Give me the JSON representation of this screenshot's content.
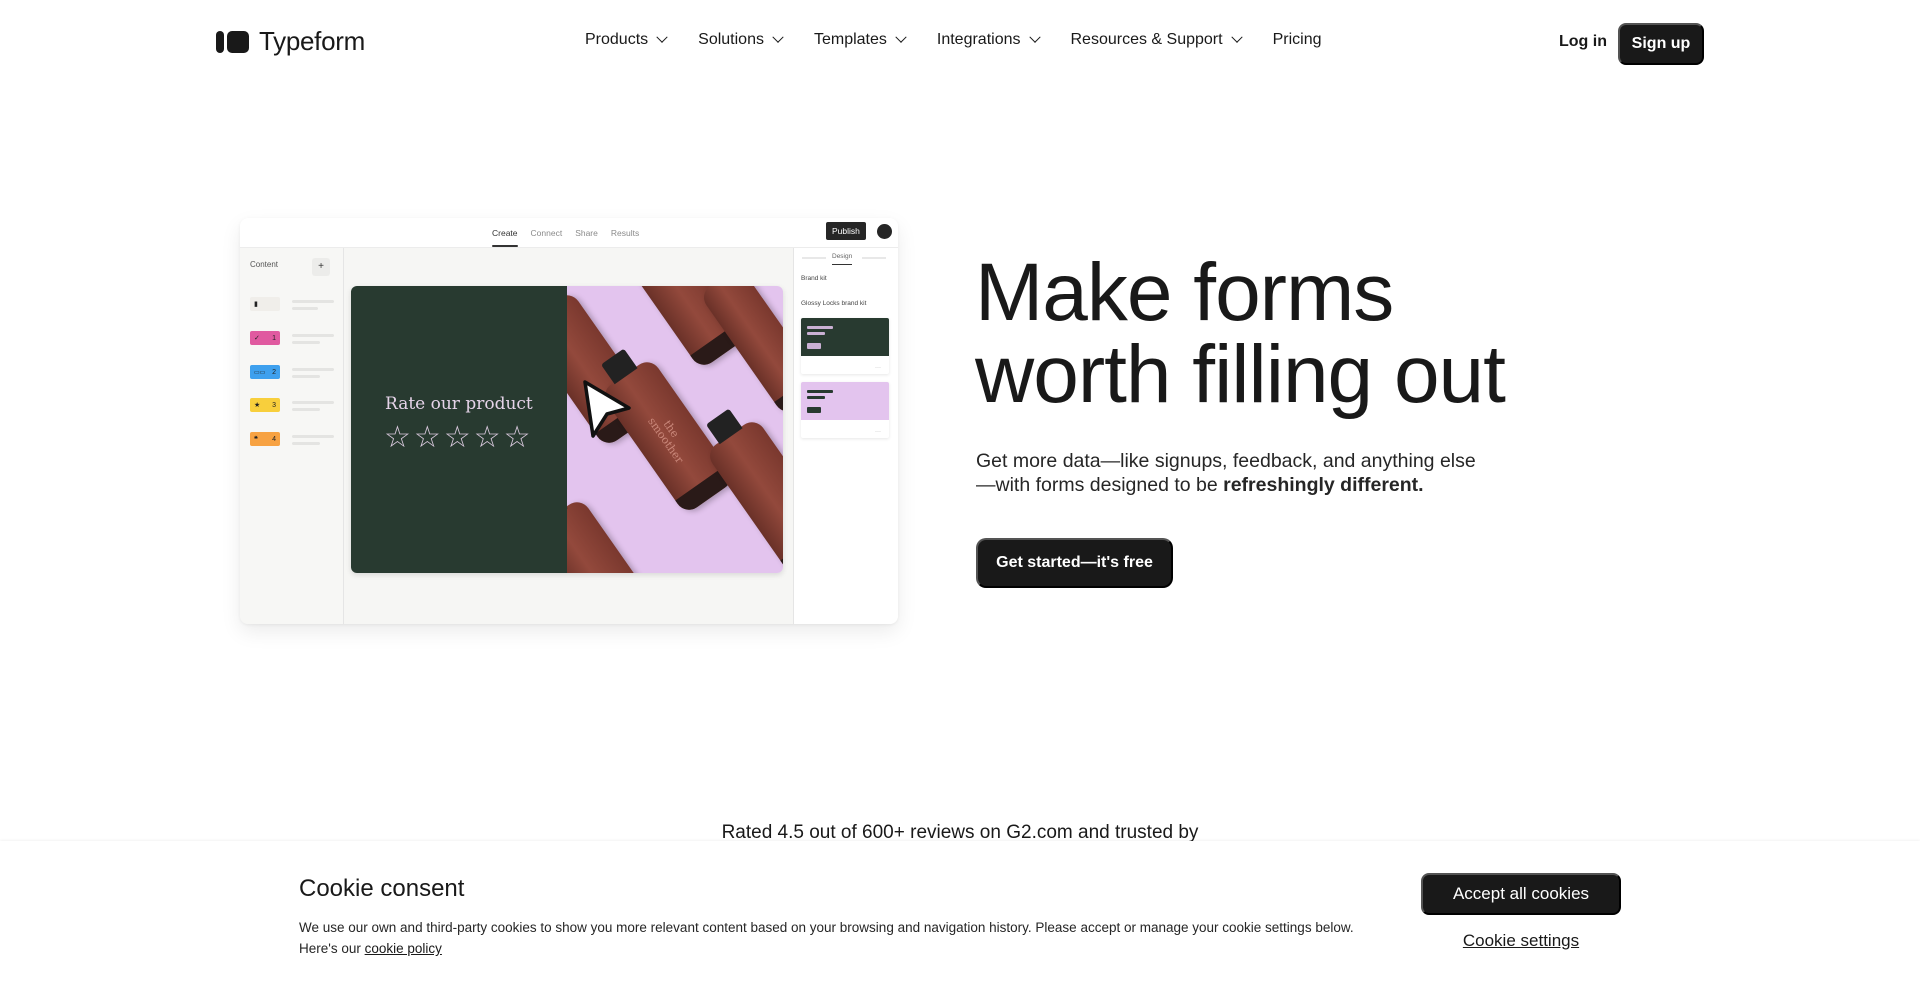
{
  "nav": {
    "brand": "Typeform",
    "menu": [
      {
        "label": "Products",
        "has_dropdown": true
      },
      {
        "label": "Solutions",
        "has_dropdown": true
      },
      {
        "label": "Templates",
        "has_dropdown": true
      },
      {
        "label": "Integrations",
        "has_dropdown": true
      },
      {
        "label": "Resources & Support",
        "has_dropdown": true
      },
      {
        "label": "Pricing",
        "has_dropdown": false
      }
    ],
    "login_label": "Log in",
    "signup_label": "Sign up"
  },
  "mock_app": {
    "tabs": [
      "Create",
      "Connect",
      "Share",
      "Results"
    ],
    "active_tab": "Create",
    "publish_label": "Publish",
    "sidebar": {
      "title": "Content",
      "add_icon": "plus-icon",
      "questions": [
        {
          "icon": "welcome-screen-icon",
          "number": "",
          "color": "#f0eeea"
        },
        {
          "icon": "check-icon",
          "number": "1",
          "color": "#e05aa0"
        },
        {
          "icon": "text-icon",
          "number": "2",
          "color": "#3ea0ee"
        },
        {
          "icon": "star-icon",
          "number": "3",
          "color": "#f8cf3c"
        },
        {
          "icon": "quote-icon",
          "number": "4",
          "color": "#f7a242"
        }
      ]
    },
    "design_panel": {
      "tab": "Design",
      "section": "Brand kit",
      "kit_name": "Glossy Locks brand kit",
      "themes": [
        {
          "bg": "#283a30",
          "accent": "#c9b0d3"
        },
        {
          "bg": "#e3c4ee",
          "accent": "#283a30"
        }
      ],
      "more_label": "···"
    },
    "canvas": {
      "question": "Rate our product",
      "stars_total": 5,
      "star_glyph": "☆",
      "left_color": "#283a30",
      "right_color": "#e3c4ee",
      "bottle_text": "the smoother"
    }
  },
  "hero": {
    "title_line1": "Make forms",
    "title_line2": "worth filling out",
    "subtitle_plain": "Get more data—like signups, feedback, and anything else —with forms designed to be ",
    "subtitle_bold": "refreshingly different.",
    "cta_label": "Get started—it's free"
  },
  "social_proof": {
    "text": "Rated 4.5 out of 600+ reviews on G2.com and trusted by"
  },
  "cookie_banner": {
    "title": "Cookie consent",
    "body": "We use our own and third-party cookies to show you more relevant content based on your browsing and navigation history. Please accept or manage your cookie settings below. Here's our ",
    "policy_link": "cookie policy",
    "accept_label": "Accept all cookies",
    "settings_label": "Cookie settings"
  }
}
